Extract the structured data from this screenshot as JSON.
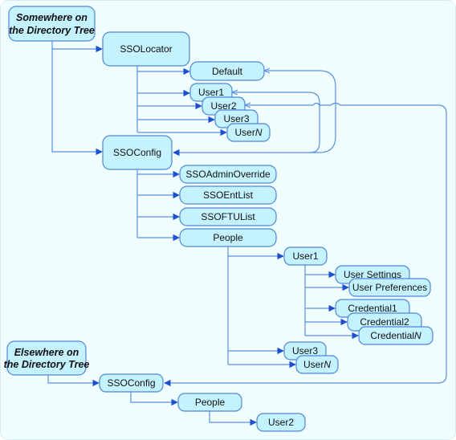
{
  "diagram": {
    "roots": {
      "somewhere": "Somewhere on the Directory Tree",
      "somewhere_line1": "Somewhere on",
      "somewhere_line2": "the Directory Tree",
      "elsewhere": "Elsewhere on the Directory Tree",
      "elsewhere_line1": "Elsewhere on",
      "elsewhere_line2": "the Directory Tree"
    },
    "sso_locator": {
      "label": "SSOLocator",
      "children": [
        "Default",
        "User1",
        "User2",
        "User3",
        "UserN"
      ]
    },
    "sso_config": {
      "label": "SSOConfig",
      "children": [
        "SSOAdminOverride",
        "SSOEntList",
        "SSOFTUList",
        "People"
      ],
      "people": {
        "children": [
          "User1",
          "User3",
          "UserN"
        ],
        "user1_children": [
          "User Settings",
          "User Preferences",
          "Credential1",
          "Credential2",
          "CredentialN"
        ]
      }
    },
    "elsewhere_config": {
      "label": "SSOConfig",
      "people": "People",
      "user": "User2"
    },
    "colors": {
      "background": "#f0feff",
      "node_fill": "#c4f2ff",
      "node_stroke": "#4f86d8",
      "connector": "#5a8fe2",
      "arrowhead": "#1d50cf"
    }
  }
}
